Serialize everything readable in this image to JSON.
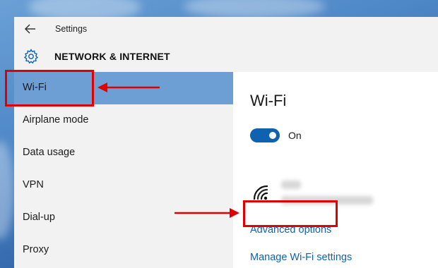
{
  "window": {
    "title": "Settings"
  },
  "header": {
    "title": "NETWORK & INTERNET"
  },
  "sidebar": {
    "items": [
      {
        "label": "Wi-Fi",
        "selected": true
      },
      {
        "label": "Airplane mode",
        "selected": false
      },
      {
        "label": "Data usage",
        "selected": false
      },
      {
        "label": "VPN",
        "selected": false
      },
      {
        "label": "Dial-up",
        "selected": false
      },
      {
        "label": "Proxy",
        "selected": false
      }
    ]
  },
  "content": {
    "title": "Wi-Fi",
    "toggle": {
      "state": "On",
      "on": true
    },
    "advanced_options_label": "Advanced options",
    "manage_wifi_label": "Manage Wi-Fi settings"
  },
  "icons": {
    "back": "back-arrow-icon",
    "settings": "gear-icon",
    "wifi": "wifi-signal-icon"
  },
  "colors": {
    "selected_item": "#6d9ed4",
    "accent": "#0f62b0",
    "link": "#1060b0",
    "annotation": "#e00000"
  }
}
